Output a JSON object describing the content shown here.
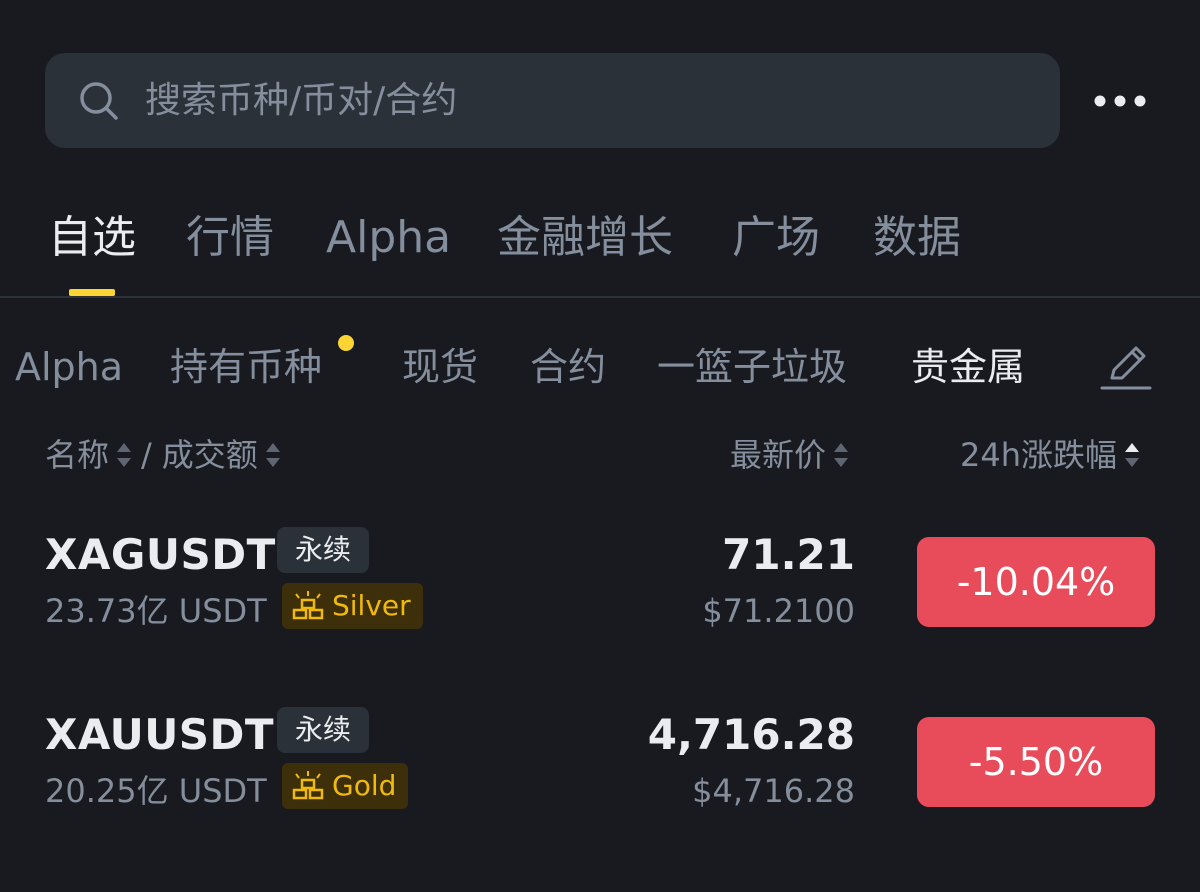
{
  "search": {
    "placeholder": "搜索币种/币对/合约"
  },
  "main_tabs": [
    {
      "label": "自选",
      "active": true
    },
    {
      "label": "行情",
      "active": false
    },
    {
      "label": "Alpha",
      "active": false
    },
    {
      "label": "金融增长",
      "active": false
    },
    {
      "label": "广场",
      "active": false
    },
    {
      "label": "数据",
      "active": false
    }
  ],
  "sub_tabs": [
    {
      "label": "Alpha",
      "active": false
    },
    {
      "label": "持有币种",
      "active": false,
      "has_dot": true
    },
    {
      "label": "现货",
      "active": false
    },
    {
      "label": "合约",
      "active": false
    },
    {
      "label": "一篮子垃圾",
      "active": false
    },
    {
      "label": "贵金属",
      "active": true
    }
  ],
  "columns": {
    "name": "名称",
    "separator": "/",
    "volume": "成交额",
    "last_price": "最新价",
    "change_24h": "24h涨跌幅"
  },
  "rows": [
    {
      "symbol": "XAGUSDT",
      "perp_label": "永续",
      "volume": "23.73亿 USDT",
      "tag": "Silver",
      "price": "71.21",
      "fiat_price": "$71.2100",
      "change": "-10.04%"
    },
    {
      "symbol": "XAUUSDT",
      "perp_label": "永续",
      "volume": "20.25亿 USDT",
      "tag": "Gold",
      "price": "4,716.28",
      "fiat_price": "$4,716.28",
      "change": "-5.50%"
    }
  ],
  "colors": {
    "background": "#181a20",
    "surface": "#2b3139",
    "accent": "#fcd535",
    "negative": "#e84c5a",
    "muted_text": "#848e9c",
    "primary_text": "#eaecef",
    "tag_text": "#f0b90b"
  },
  "icons": {
    "search": "search-icon",
    "more": "more-dots-icon",
    "edit": "pencil-edit-icon",
    "sort": "sort-arrows-icon",
    "metal": "gold-bars-icon"
  }
}
